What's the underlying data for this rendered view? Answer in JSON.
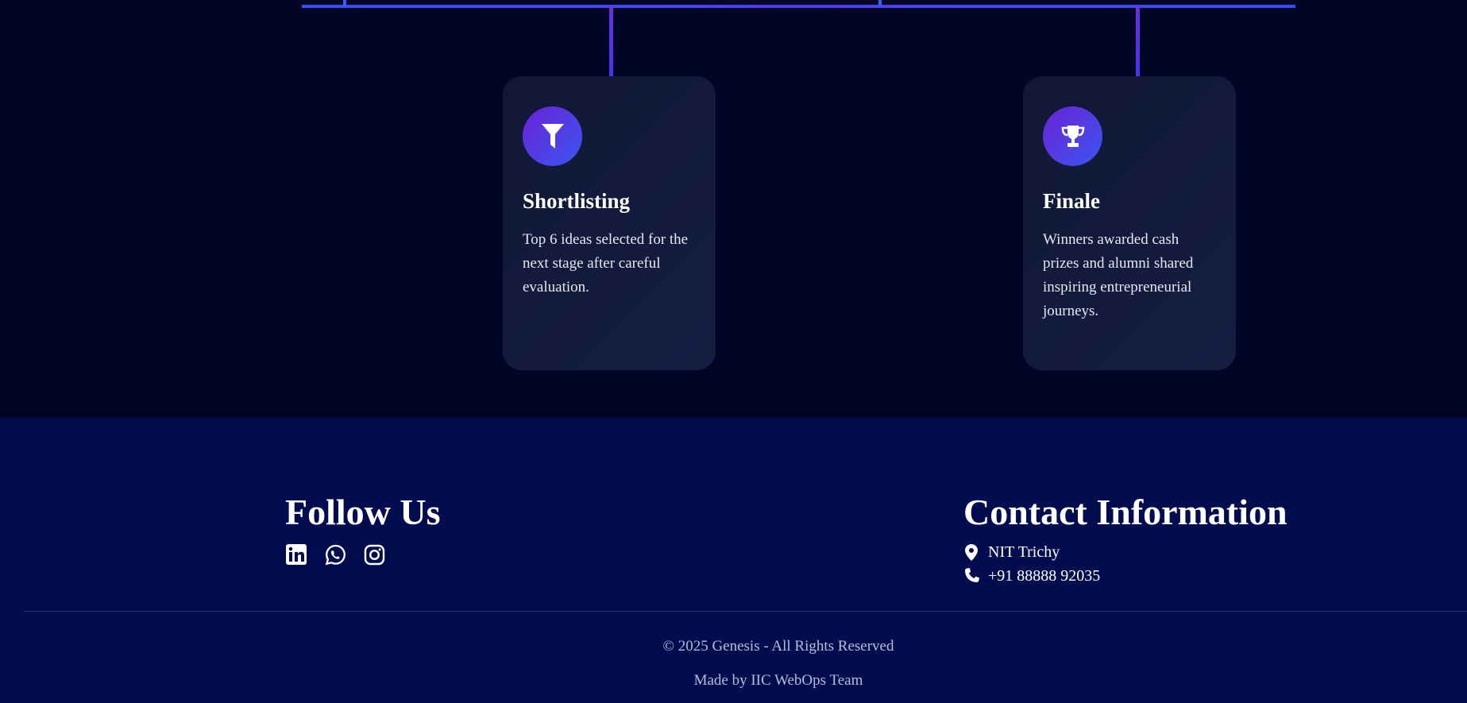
{
  "timeline": {
    "cards": [
      {
        "icon": "filter-icon",
        "title": "Shortlisting",
        "description": "Top 6 ideas selected for the next stage after careful evaluation."
      },
      {
        "icon": "trophy-icon",
        "title": "Finale",
        "description": "Winners awarded cash prizes and alumni shared inspiring entrepreneurial journeys."
      }
    ]
  },
  "footer": {
    "follow": {
      "heading": "Follow Us",
      "socials": [
        {
          "icon": "linkedin-icon"
        },
        {
          "icon": "whatsapp-icon"
        },
        {
          "icon": "instagram-icon"
        }
      ]
    },
    "contact": {
      "heading": "Contact Information",
      "location": "NIT Trichy",
      "phone": "+91 88888 92035",
      "location_icon": "map-pin-icon",
      "phone_icon": "phone-icon"
    },
    "copyright": "© 2025 Genesis - All Rights Reserved",
    "credit": "Made by IIC WebOps Team"
  },
  "colors": {
    "background": "#020626",
    "footer_bg": "#020d50",
    "card_bg": "#131a3c",
    "accent_purple": "#6a22d6",
    "accent_blue": "#3b56f0"
  }
}
